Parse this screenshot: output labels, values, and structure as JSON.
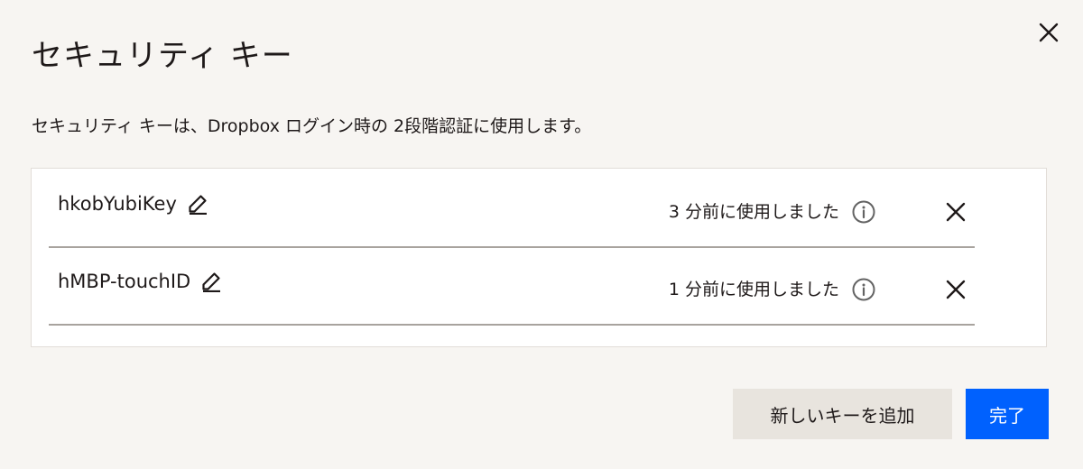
{
  "dialog": {
    "title": "セキュリティ キー",
    "description": "セキュリティ キーは、Dropbox ログイン時の 2段階認証に使用します。",
    "close_icon": "close-icon"
  },
  "keys": [
    {
      "name": "hkobYubiKey",
      "last_used": "3 分前に使用しました",
      "edit_icon": "pencil-icon",
      "info_icon": "info-icon",
      "remove_icon": "close-icon"
    },
    {
      "name": "hMBP-touchID",
      "last_used": "1 分前に使用しました",
      "edit_icon": "pencil-icon",
      "info_icon": "info-icon",
      "remove_icon": "close-icon"
    }
  ],
  "actions": {
    "add_key_label": "新しいキーを追加",
    "done_label": "完了"
  },
  "colors": {
    "background": "#f7f5f2",
    "panel": "#ffffff",
    "primary": "#0061fe",
    "secondary_button": "#e8e4de",
    "text": "#1e1919"
  }
}
